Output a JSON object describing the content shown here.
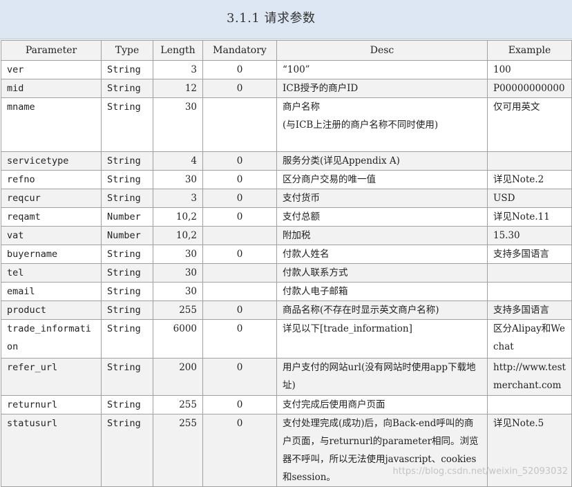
{
  "section_title": "3.1.1 请求参数",
  "headers": {
    "parameter": "Parameter",
    "type": "Type",
    "length": "Length",
    "mandatory": "Mandatory",
    "desc": "Desc",
    "example": "Example"
  },
  "rows": [
    {
      "parameter": "ver",
      "type": "String",
      "length": "3",
      "mandatory": "0",
      "desc": "“100”",
      "example": "100"
    },
    {
      "parameter": "mid",
      "type": "String",
      "length": "12",
      "mandatory": "0",
      "desc": "ICB授予的商户ID",
      "example": "P00000000000"
    },
    {
      "parameter": "mname",
      "type": "String",
      "length": "30",
      "mandatory": "",
      "desc": "商户名称\n(与ICB上注册的商户名称不同时使用)",
      "example": "仅可用英文"
    },
    {
      "parameter": "servicetype",
      "type": "String",
      "length": "4",
      "mandatory": "0",
      "desc": "服务分类(详见Appendix A)",
      "example": ""
    },
    {
      "parameter": "refno",
      "type": "String",
      "length": "30",
      "mandatory": "0",
      "desc": "区分商户交易的唯一值",
      "example": "详见Note.2"
    },
    {
      "parameter": "reqcur",
      "type": "String",
      "length": "3",
      "mandatory": "0",
      "desc": "支付货币",
      "example": "USD"
    },
    {
      "parameter": "reqamt",
      "type": "Number",
      "length": "10,2",
      "mandatory": "0",
      "desc": "支付总额",
      "example": "详见Note.11"
    },
    {
      "parameter": "vat",
      "type": "Number",
      "length": "10,2",
      "mandatory": "",
      "desc": "附加税",
      "example": "15.30"
    },
    {
      "parameter": "buyername",
      "type": "String",
      "length": "30",
      "mandatory": "0",
      "desc": "付款人姓名",
      "example": "支持多国语言"
    },
    {
      "parameter": "tel",
      "type": "String",
      "length": "30",
      "mandatory": "",
      "desc": "付款人联系方式",
      "example": ""
    },
    {
      "parameter": "email",
      "type": "String",
      "length": "30",
      "mandatory": "",
      "desc": "付款人电子邮箱",
      "example": ""
    },
    {
      "parameter": "product",
      "type": "String",
      "length": "255",
      "mandatory": "0",
      "desc": "商品名称(不存在时显示英文商户名称)",
      "example": "支持多国语言"
    },
    {
      "parameter": "trade_information",
      "type": "String",
      "length": "6000",
      "mandatory": "0",
      "desc": "详见以下[trade_information]",
      "example": "区分Alipay和Wechat"
    },
    {
      "parameter": "refer_url",
      "type": "String",
      "length": "200",
      "mandatory": "0",
      "desc": "用户支付的网站url(没有网站时使用app下载地址)",
      "example": "http://www.testmerchant.com"
    },
    {
      "parameter": "returnurl",
      "type": "String",
      "length": "255",
      "mandatory": "0",
      "desc": "支付完成后使用商户页面",
      "example": ""
    },
    {
      "parameter": "statusurl",
      "type": "String",
      "length": "255",
      "mandatory": "0",
      "desc": "支付处理完成(成功)后，向Back-end呼叫的商户页面，与returnurl的parameter相同。浏览器不呼叫，所以无法使用javascript、cookies和session。",
      "example": "详见Note.5"
    }
  ],
  "watermark": "https://blog.csdn.net/weixin_52093032"
}
